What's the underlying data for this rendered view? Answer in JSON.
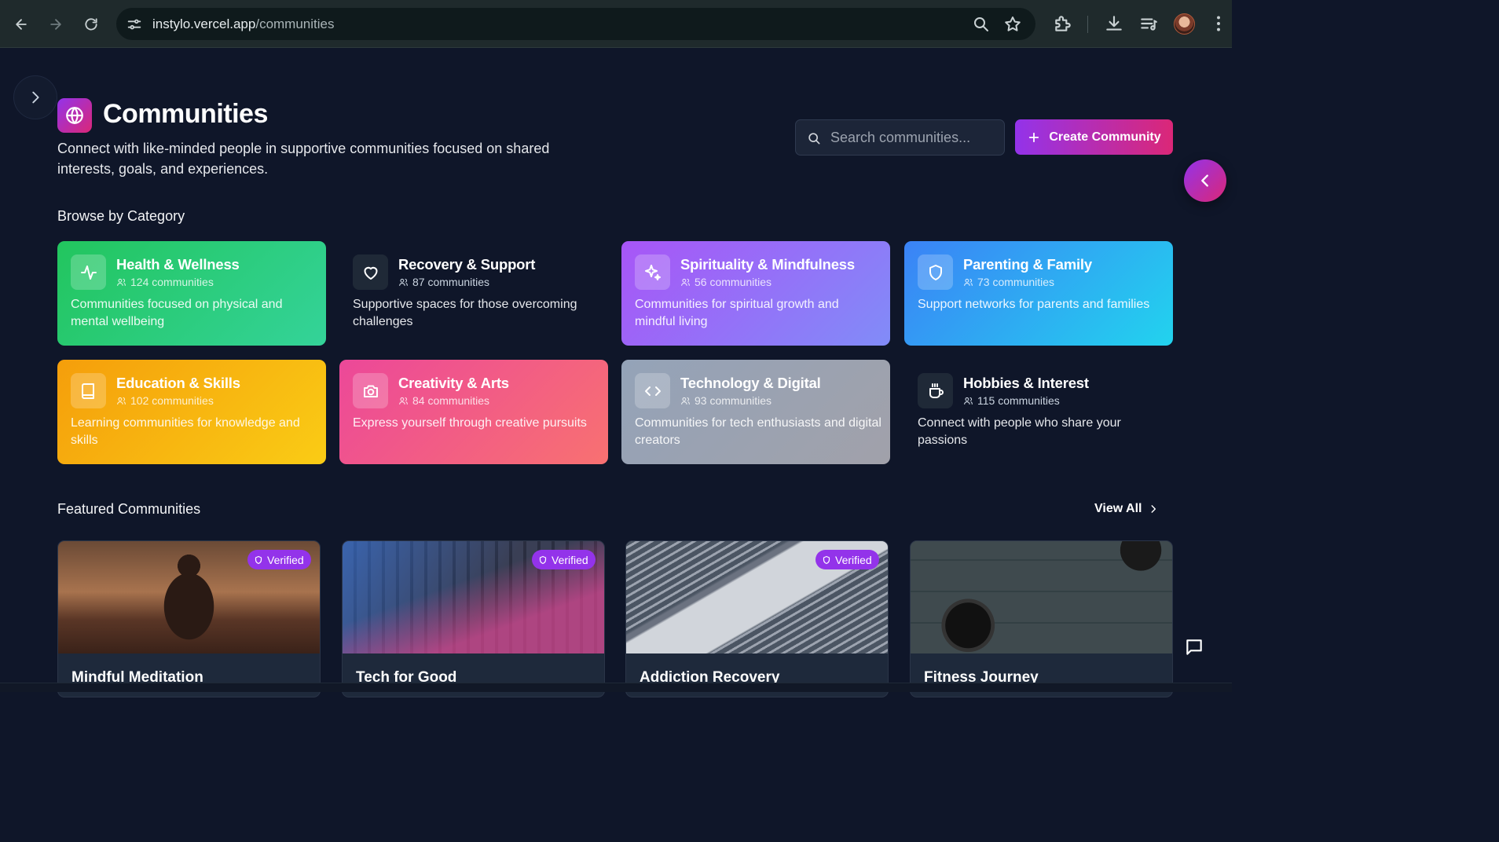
{
  "browser": {
    "url_host": "instylo.vercel.app",
    "url_path": "/communities"
  },
  "header": {
    "title": "Communities",
    "description": "Connect with like-minded people in supportive communities focused on shared interests, goals, and experiences.",
    "search_placeholder": "Search communities...",
    "create_label": "Create Community"
  },
  "categories": {
    "title": "Browse by Category",
    "items": [
      {
        "name": "Health & Wellness",
        "count": "124 communities",
        "description": "Communities focused on physical and mental wellbeing",
        "icon": "activity-icon",
        "color": "#22c55e"
      },
      {
        "name": "Recovery & Support",
        "count": "87 communities",
        "description": "Supportive spaces for those overcoming challenges",
        "icon": "heart-icon",
        "color": "#0f1629"
      },
      {
        "name": "Spirituality & Mindfulness",
        "count": "56 communities",
        "description": "Communities for spiritual growth and mindful living",
        "icon": "sparkles-icon",
        "color": "#a855f7"
      },
      {
        "name": "Parenting & Family",
        "count": "73 communities",
        "description": "Support networks for parents and families",
        "icon": "shield-icon",
        "color": "#3b82f6"
      },
      {
        "name": "Education & Skills",
        "count": "102 communities",
        "description": "Learning communities for knowledge and skills",
        "icon": "book-icon",
        "color": "#f59e0b"
      },
      {
        "name": "Creativity & Arts",
        "count": "84 communities",
        "description": "Express yourself through creative pursuits",
        "icon": "camera-icon",
        "color": "#ec4899"
      },
      {
        "name": "Technology & Digital",
        "count": "93 communities",
        "description": "Communities for tech enthusiasts and digital creators",
        "icon": "code-icon",
        "color": "#9ca3af"
      },
      {
        "name": "Hobbies & Interest",
        "count": "115 communities",
        "description": "Connect with people who share your passions",
        "icon": "coffee-icon",
        "color": "#0f1629"
      }
    ]
  },
  "featured": {
    "title": "Featured Communities",
    "view_all": "View All",
    "items": [
      {
        "name": "Mindful Meditation",
        "badge": "Verified"
      },
      {
        "name": "Tech for Good",
        "badge": "Verified"
      },
      {
        "name": "Addiction Recovery",
        "badge": "Verified"
      },
      {
        "name": "Fitness Journey",
        "badge": ""
      }
    ]
  }
}
